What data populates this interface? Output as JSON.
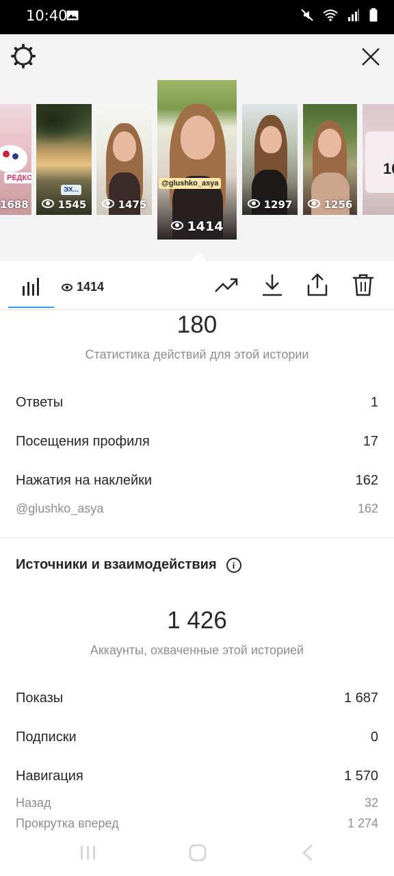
{
  "status_bar": {
    "time": "10:40"
  },
  "stories": [
    {
      "views": "1688",
      "tag": "РЕДКО"
    },
    {
      "views": "1545",
      "tag": "ЭХ..."
    },
    {
      "views": "1475"
    },
    {
      "views": "1414",
      "tag": "@glushko_asya"
    },
    {
      "views": "1297"
    },
    {
      "views": "1256"
    },
    {
      "views": ""
    }
  ],
  "toolbar": {
    "views": "1414"
  },
  "actions": {
    "total": "180",
    "caption": "Статистика действий для этой истории",
    "rows": [
      {
        "label": "Ответы",
        "value": "1"
      },
      {
        "label": "Посещения профиля",
        "value": "17"
      },
      {
        "label": "Нажатия на наклейки",
        "value": "162"
      }
    ],
    "sub_rows": [
      {
        "label": "@glushko_asya",
        "value": "162"
      }
    ]
  },
  "sources": {
    "title": "Источники и взаимодействия",
    "total": "1 426",
    "caption": "Аккаунты, охваченные этой историей",
    "rows": [
      {
        "label": "Показы",
        "value": "1 687"
      },
      {
        "label": "Подписки",
        "value": "0"
      },
      {
        "label": "Навигация",
        "value": "1 570"
      }
    ],
    "sub_rows": [
      {
        "label": "Назад",
        "value": "32"
      },
      {
        "label": "Прокрутка вперед",
        "value": "1 274"
      }
    ]
  }
}
